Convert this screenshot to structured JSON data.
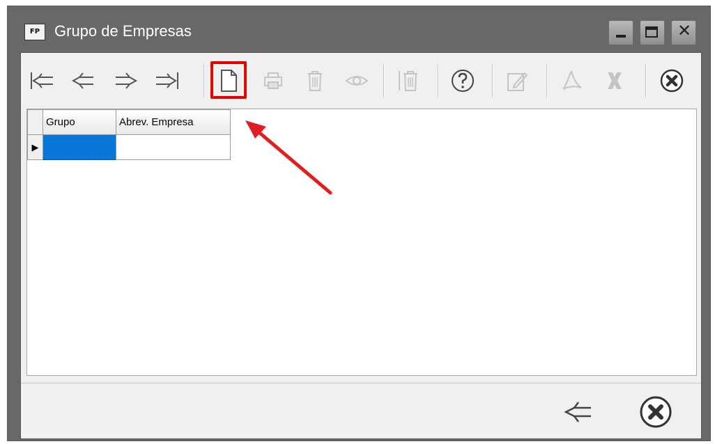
{
  "window": {
    "icon_text": "FP",
    "title": "Grupo de Empresas",
    "controls": [
      "minimize-icon",
      "maximize-icon",
      "close-icon"
    ]
  },
  "toolbar": {
    "buttons": [
      {
        "name": "first-record",
        "icon": "first-record-icon",
        "enabled": true
      },
      {
        "name": "previous-record",
        "icon": "previous-record-icon",
        "enabled": true
      },
      {
        "name": "next-record",
        "icon": "next-record-icon",
        "enabled": true
      },
      {
        "name": "last-record",
        "icon": "last-record-icon",
        "enabled": true
      },
      {
        "name": "new-record",
        "icon": "new-document-icon",
        "enabled": true,
        "highlighted": true
      },
      {
        "name": "print",
        "icon": "printer-icon",
        "enabled": false
      },
      {
        "name": "delete",
        "icon": "trash-icon",
        "enabled": false
      },
      {
        "name": "view",
        "icon": "eye-icon",
        "enabled": false
      },
      {
        "name": "delete-all",
        "icon": "trash-bar-icon",
        "enabled": false
      },
      {
        "name": "help",
        "icon": "question-icon",
        "enabled": true
      },
      {
        "name": "edit",
        "icon": "edit-icon",
        "enabled": false
      },
      {
        "name": "export-pdf",
        "icon": "pdf-icon",
        "enabled": false
      },
      {
        "name": "export-excel",
        "icon": "excel-icon",
        "enabled": false
      },
      {
        "name": "close",
        "icon": "close-circle-icon",
        "enabled": true
      }
    ]
  },
  "grid": {
    "columns": [
      "Grupo",
      "Abrev. Empresa"
    ],
    "rows": [
      [
        "",
        ""
      ]
    ],
    "selected_cell": "Grupo"
  },
  "bottom": {
    "buttons": [
      {
        "name": "back",
        "icon": "back-arrow-icon"
      },
      {
        "name": "close",
        "icon": "close-circle-icon"
      }
    ]
  },
  "colors": {
    "highlight": "#e60000",
    "selection": "#0a76d7",
    "window_frame": "#686868",
    "client_bg": "#f0f0f0"
  }
}
